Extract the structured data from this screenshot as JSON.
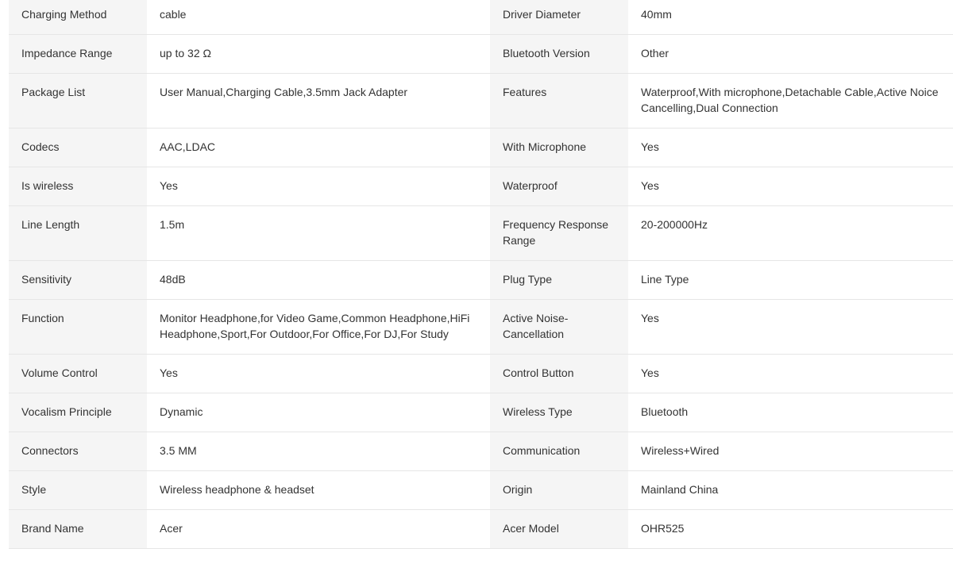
{
  "specs": {
    "rows": [
      {
        "left_name": "Charging Method",
        "left_value": "cable",
        "right_name": "Driver Diameter",
        "right_value": "40mm"
      },
      {
        "left_name": "Impedance Range",
        "left_value": "up to 32 Ω",
        "right_name": "Bluetooth Version",
        "right_value": "Other"
      },
      {
        "left_name": "Package List",
        "left_value": "User Manual,Charging Cable,3.5mm Jack Adapter",
        "right_name": "Features",
        "right_value": "Waterproof,With microphone,Detachable Cable,Active Noice Cancelling,Dual Connection"
      },
      {
        "left_name": "Codecs",
        "left_value": "AAC,LDAC",
        "right_name": "With Microphone",
        "right_value": "Yes"
      },
      {
        "left_name": "Is wireless",
        "left_value": "Yes",
        "right_name": "Waterproof",
        "right_value": "Yes"
      },
      {
        "left_name": "Line Length",
        "left_value": "1.5m",
        "right_name": "Frequency Response Range",
        "right_value": "20-200000Hz"
      },
      {
        "left_name": "Sensitivity",
        "left_value": "48dB",
        "right_name": "Plug Type",
        "right_value": "Line Type"
      },
      {
        "left_name": "Function",
        "left_value": "Monitor Headphone,for Video Game,Common Headphone,HiFi Headphone,Sport,For Outdoor,For Office,For DJ,For Study",
        "right_name": "Active Noise-Cancellation",
        "right_value": "Yes"
      },
      {
        "left_name": "Volume Control",
        "left_value": "Yes",
        "right_name": "Control Button",
        "right_value": "Yes"
      },
      {
        "left_name": "Vocalism Principle",
        "left_value": "Dynamic",
        "right_name": "Wireless Type",
        "right_value": "Bluetooth"
      },
      {
        "left_name": "Connectors",
        "left_value": "3.5 MM",
        "right_name": "Communication",
        "right_value": "Wireless+Wired"
      },
      {
        "left_name": "Style",
        "left_value": "Wireless headphone & headset",
        "right_name": "Origin",
        "right_value": "Mainland China"
      },
      {
        "left_name": "Brand Name",
        "left_value": "Acer",
        "right_name": "Acer Model",
        "right_value": "OHR525"
      }
    ]
  }
}
